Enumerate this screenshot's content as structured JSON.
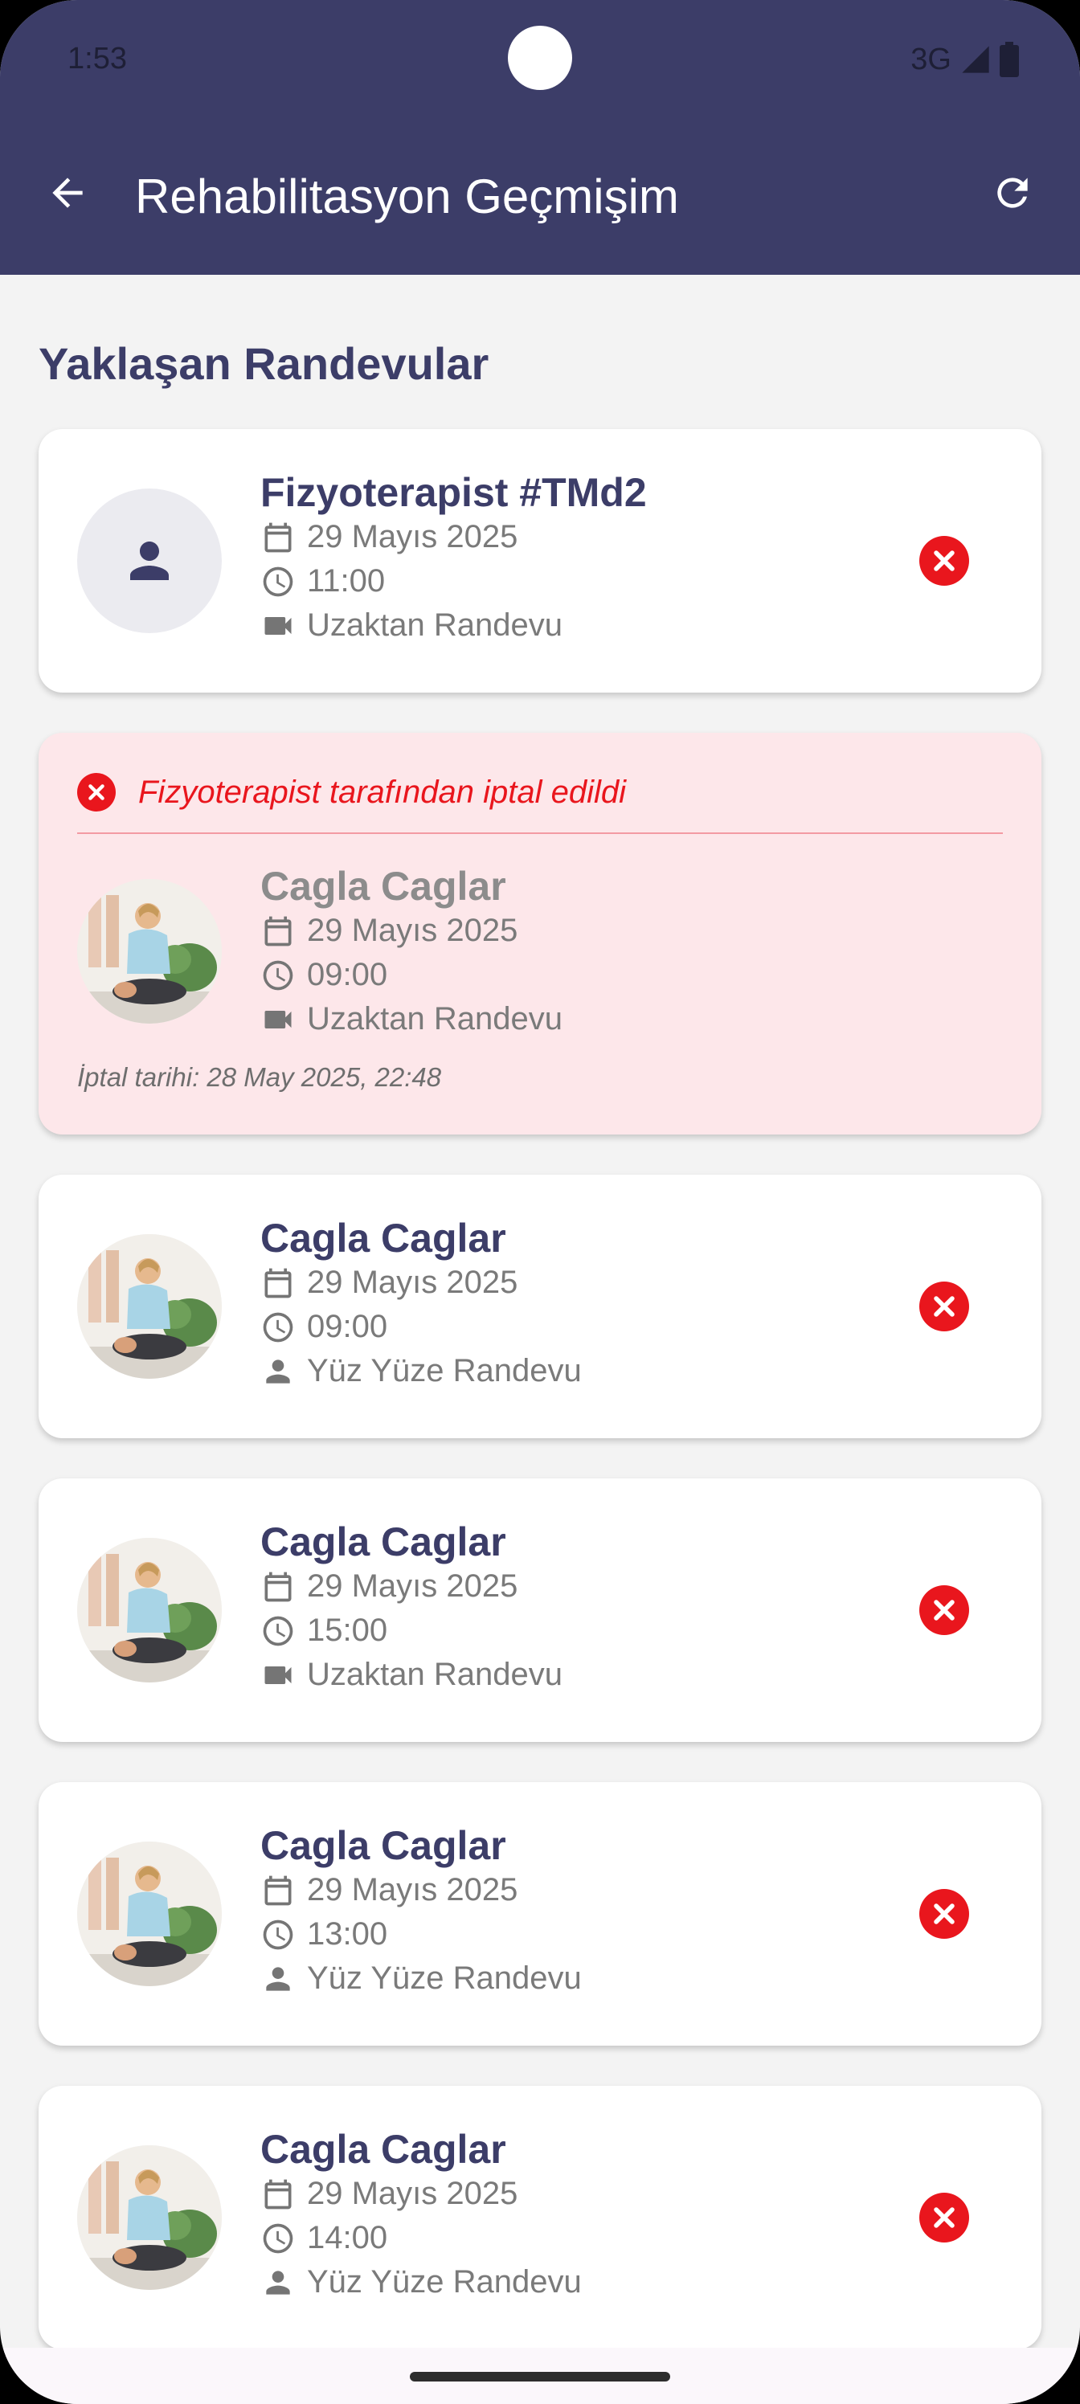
{
  "status_bar": {
    "time": "1:53",
    "network": "3G"
  },
  "header": {
    "title": "Rehabilitasyon Geçmişim"
  },
  "section": {
    "title": "Yaklaşan Randevular"
  },
  "appointments": [
    {
      "name": "Fizyoterapist #TMd2",
      "date": "29 Mayıs 2025",
      "time": "11:00",
      "type": "Uzaktan Randevu",
      "type_icon": "video-icon",
      "avatar": "person-placeholder"
    },
    {
      "name": "Cagla Caglar",
      "date": "29 Mayıs 2025",
      "time": "09:00",
      "type": "Uzaktan Randevu",
      "type_icon": "video-icon",
      "avatar": "photo",
      "cancelled": true,
      "cancel_message": "Fizyoterapist tarafından iptal edildi",
      "cancel_date": "İptal tarihi: 28 May 2025, 22:48"
    },
    {
      "name": "Cagla Caglar",
      "date": "29 Mayıs 2025",
      "time": "09:00",
      "type": "Yüz Yüze Randevu",
      "type_icon": "person-icon",
      "avatar": "photo"
    },
    {
      "name": "Cagla Caglar",
      "date": "29 Mayıs 2025",
      "time": "15:00",
      "type": "Uzaktan Randevu",
      "type_icon": "video-icon",
      "avatar": "photo"
    },
    {
      "name": "Cagla Caglar",
      "date": "29 Mayıs 2025",
      "time": "13:00",
      "type": "Yüz Yüze Randevu",
      "type_icon": "person-icon",
      "avatar": "photo"
    },
    {
      "name": "Cagla Caglar",
      "date": "29 Mayıs 2025",
      "time": "14:00",
      "type": "Yüz Yüze Randevu",
      "type_icon": "person-icon",
      "avatar": "photo"
    }
  ],
  "colors": {
    "primary": "#3c3d68",
    "danger": "#e9161d",
    "cancelled_bg": "#fde7ea",
    "background": "#f3f3f3"
  }
}
